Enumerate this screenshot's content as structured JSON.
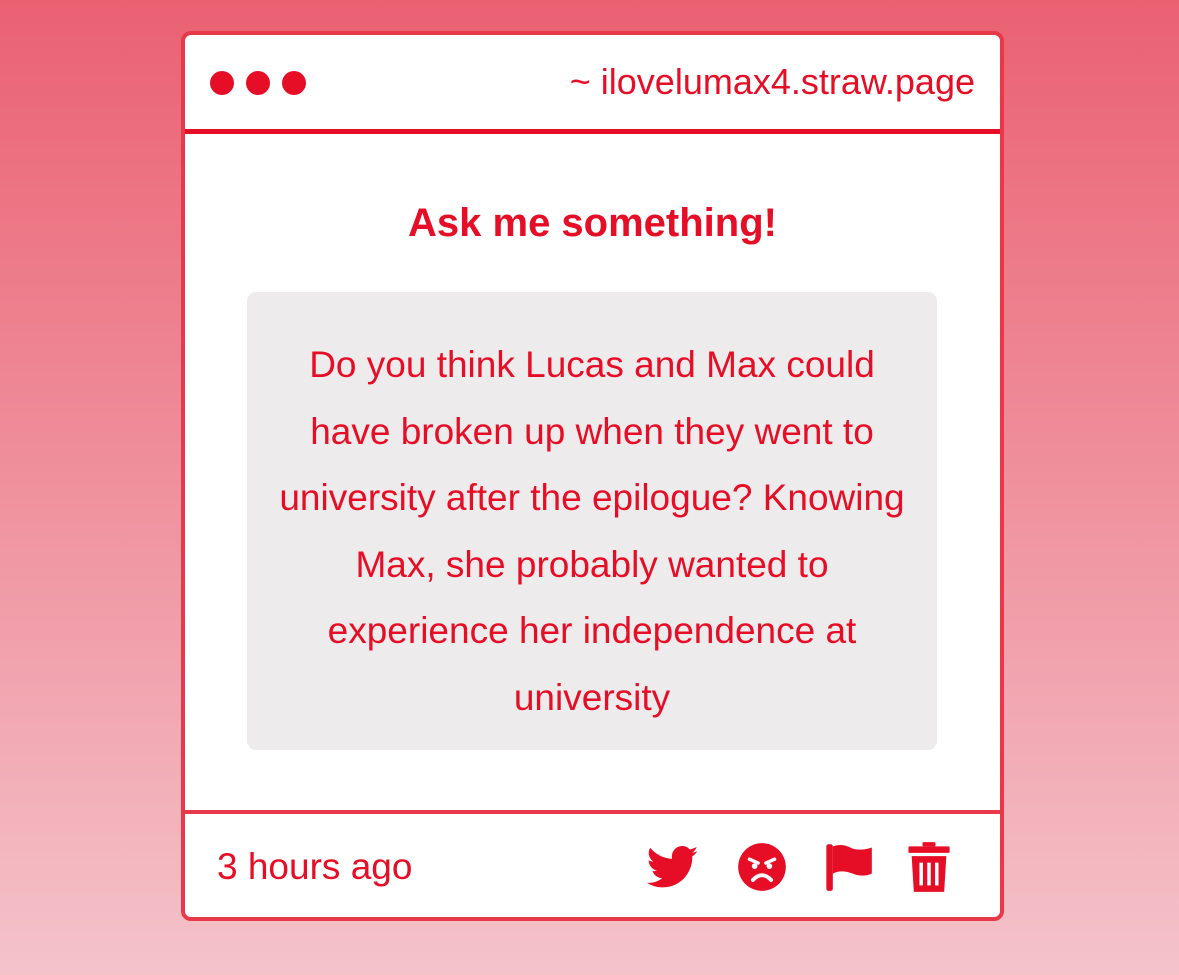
{
  "window": {
    "url": "~ ilovelumax4.straw.page",
    "dots": [
      "dot-1",
      "dot-2",
      "dot-3"
    ]
  },
  "main": {
    "heading": "Ask me something!",
    "question": "Do you think Lucas and Max could have broken up when they went to university after the epilogue? Knowing Max, she probably wanted to experience her independence at university"
  },
  "footer": {
    "timestamp": "3 hours ago",
    "icons": [
      "twitter-icon",
      "angry-face-icon",
      "flag-icon",
      "trash-icon"
    ]
  },
  "colors": {
    "accent": "#e60e26",
    "border": "#e8394b",
    "question_bg": "#edebec",
    "background_top": "#ea6172",
    "background_bottom": "#f4c3ca"
  }
}
